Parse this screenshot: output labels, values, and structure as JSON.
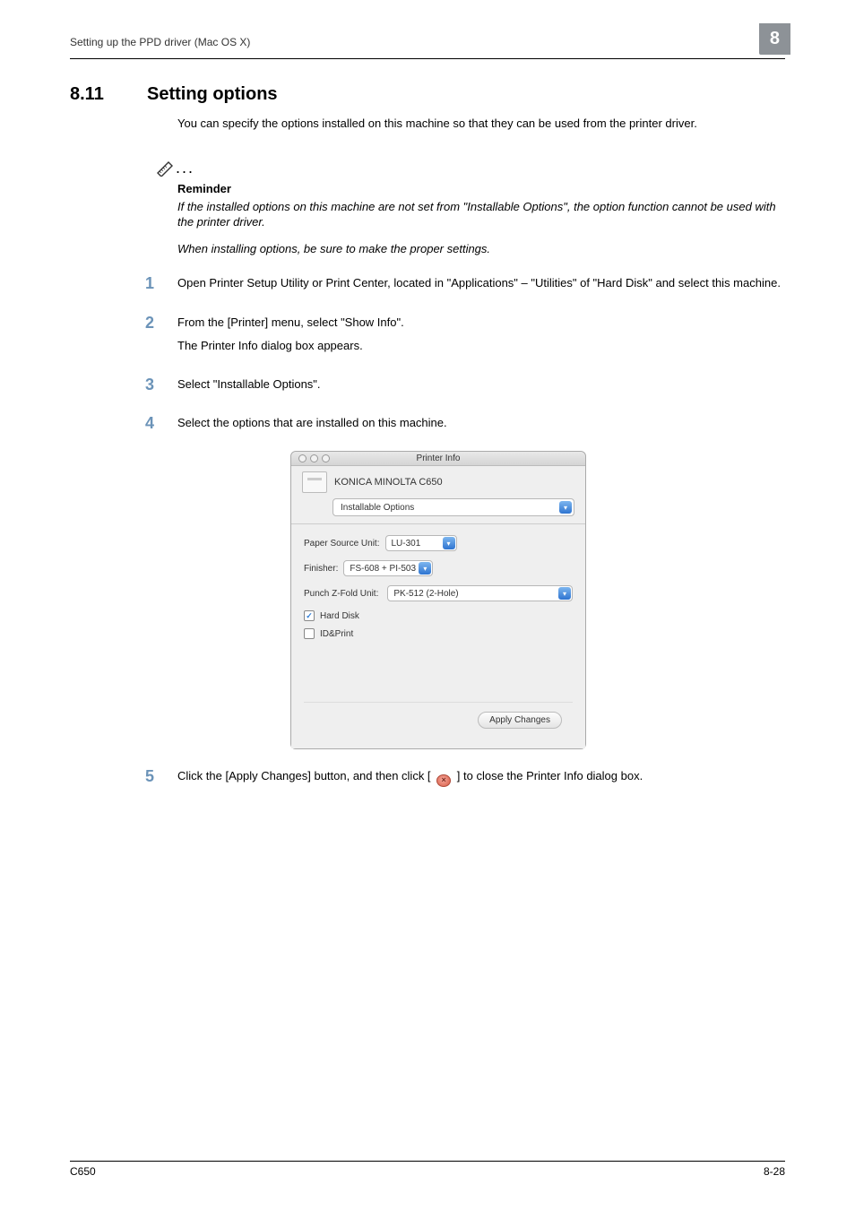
{
  "runningHead": "Setting up the PPD driver (Mac OS X)",
  "chapterNumber": "8",
  "section": {
    "number": "8.11",
    "title": "Setting options"
  },
  "intro": "You can specify the options installed on this machine so that they can be used from the printer driver.",
  "reminder": {
    "title": "Reminder",
    "line1": "If the installed options on this machine are not set from \"Installable Options\", the option function cannot be used with the printer driver.",
    "line2": "When installing options, be sure to make the proper settings."
  },
  "steps": {
    "s1": "Open Printer Setup Utility or Print Center, located in \"Applications\" – \"Utilities\" of \"Hard Disk\" and select this machine.",
    "s2a": "From the [Printer] menu, select \"Show Info\".",
    "s2b": "The Printer Info dialog box appears.",
    "s3": "Select \"Installable Options\".",
    "s4": "Select the options that are installed on this machine.",
    "s5a": "Click the [Apply Changes] button, and then click [",
    "s5b": "] to close the Printer Info dialog box."
  },
  "stepNums": {
    "n1": "1",
    "n2": "2",
    "n3": "3",
    "n4": "4",
    "n5": "5"
  },
  "macWindow": {
    "title": "Printer Info",
    "printerName": "KONICA MINOLTA C650",
    "sectionSelect": "Installable Options",
    "rows": {
      "paperSource": {
        "label": "Paper Source Unit:",
        "value": "LU-301"
      },
      "finisher": {
        "label": "Finisher:",
        "value": "FS-608 + PI-503"
      },
      "punch": {
        "label": "Punch Z-Fold Unit:",
        "value": "PK-512 (2-Hole)"
      }
    },
    "checks": {
      "hardDisk": "Hard Disk",
      "idPrint": "ID&Print"
    },
    "applyBtn": "Apply Changes",
    "closeGlyph": "×"
  },
  "footer": {
    "left": "C650",
    "right": "8-28"
  },
  "caret": "▾",
  "tick": "✓"
}
